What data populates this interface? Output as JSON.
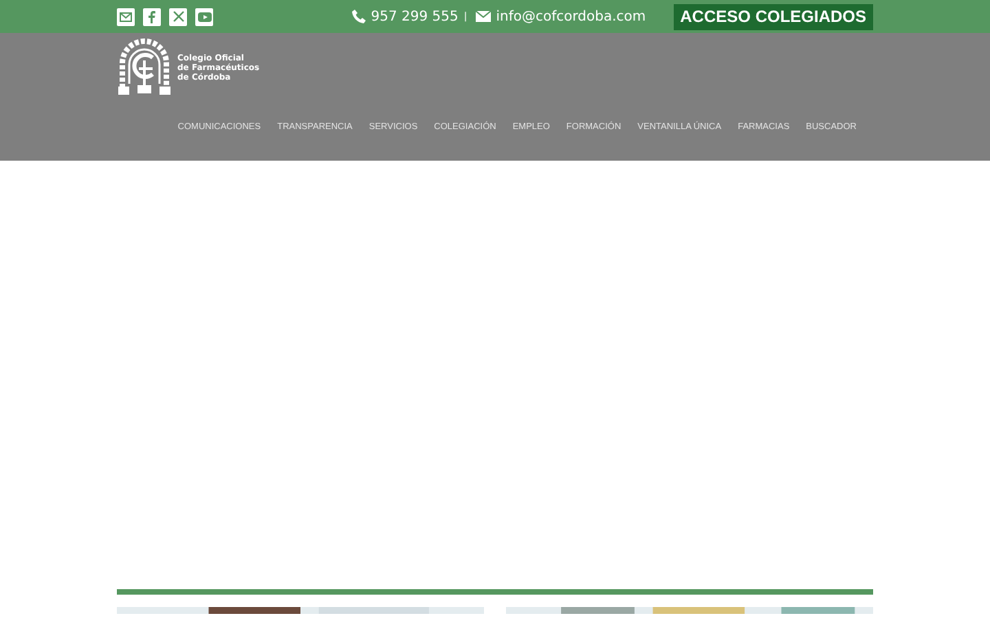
{
  "topbar": {
    "social": [
      {
        "kind": "mail"
      },
      {
        "kind": "facebook"
      },
      {
        "kind": "x"
      },
      {
        "kind": "youtube"
      }
    ],
    "phone": "957 299 555",
    "separator": "|",
    "email": "info@cofcordoba.com",
    "cta": "ACCESO COLEGIADOS"
  },
  "header": {
    "logo_text": [
      "Colegio Oficial",
      "de Farmacéuticos",
      "de Córdoba"
    ],
    "nav": [
      "COMUNICACIONES",
      "TRANSPARENCIA",
      "SERVICIOS",
      "COLEGIACIÓN",
      "EMPLEO",
      "FORMACIÓN",
      "VENTANILLA ÚNICA",
      "FARMACIAS",
      "BUSCADOR"
    ]
  }
}
